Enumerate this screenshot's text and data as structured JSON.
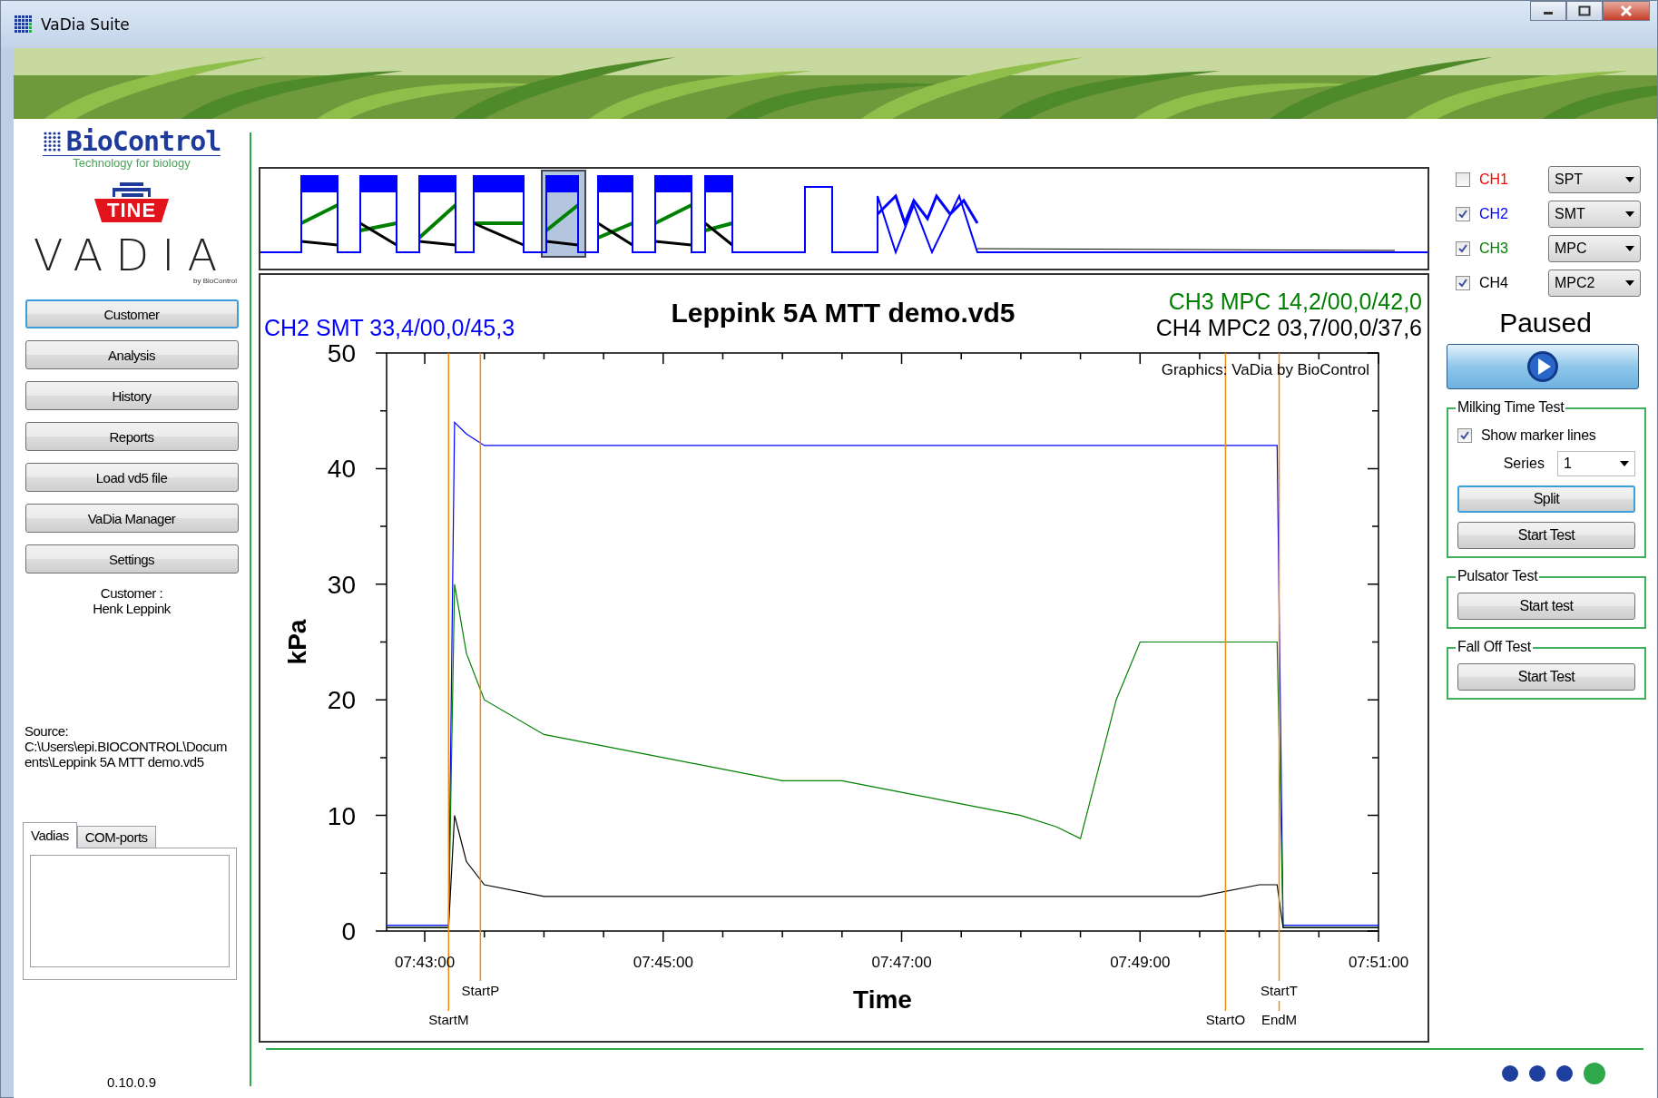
{
  "window": {
    "title": "VaDia Suite"
  },
  "sidebar": {
    "logos": {
      "brand": "BioControl",
      "tagline": "Technology for biology",
      "partner": "TINE",
      "product": "VADIA",
      "product_byline": "by BioControl"
    },
    "buttons": [
      {
        "label": "Customer",
        "focused": true
      },
      {
        "label": "Analysis",
        "focused": false
      },
      {
        "label": "History",
        "focused": false
      },
      {
        "label": "Reports",
        "focused": false
      },
      {
        "label": "Load vd5 file",
        "focused": false
      },
      {
        "label": "VaDia Manager",
        "focused": false
      },
      {
        "label": "Settings",
        "focused": false
      }
    ],
    "customer": {
      "label": "Customer :",
      "name": "Henk Leppink"
    },
    "source": {
      "label": "Source:",
      "path": "C:\\Users\\epi.BIOCONTROL\\Documents\\Leppink 5A MTT demo.vd5"
    },
    "tabs": [
      {
        "label": "Vadias",
        "selected": true
      },
      {
        "label": "COM-ports",
        "selected": false
      }
    ],
    "version": "0.10.0.9"
  },
  "chart_panel": {
    "title": "Leppink 5A MTT demo.vd5",
    "readings": [
      {
        "text": "CH2 SMT 33,4/00,0/45,3",
        "color": "#0000ff"
      },
      {
        "text": "CH3 MPC 14,2/00,0/42,0",
        "color": "#008000"
      },
      {
        "text": "CH4 MPC2 03,7/00,0/37,6",
        "color": "#000000"
      }
    ],
    "credit": "Graphics: VaDia by BioControl",
    "chart_data": {
      "type": "line",
      "xlabel": "Time",
      "ylabel": "kPa",
      "x": [
        27760.8,
        27792,
        27795,
        27801,
        27810,
        27840,
        27870,
        27900,
        27930,
        27960,
        27990,
        28020,
        28050,
        28080,
        28098,
        28110,
        28128,
        28140,
        28170,
        28200,
        28209,
        28212,
        28260
      ],
      "series": [
        {
          "color": "#0000ff",
          "values": [
            0.5,
            0.5,
            44,
            43,
            42,
            42,
            42,
            42,
            42,
            42,
            42,
            42,
            42,
            42,
            42,
            42,
            42,
            42,
            42,
            42,
            42,
            0.5,
            0.5
          ]
        },
        {
          "color": "#008000",
          "values": [
            0.3,
            0.3,
            30,
            24,
            20,
            17,
            16,
            15,
            14,
            13,
            13,
            12,
            11,
            10,
            9,
            8,
            20,
            25,
            25,
            25,
            25,
            0.3,
            0.3
          ]
        },
        {
          "color": "#000000",
          "values": [
            0.3,
            0.3,
            10,
            6,
            4,
            3,
            3,
            3,
            3,
            3,
            3,
            3,
            3,
            3,
            3,
            3,
            3,
            3,
            3,
            4,
            4,
            0.3,
            0.3
          ]
        }
      ],
      "xlim": [
        27760.8,
        28260
      ],
      "ylim": [
        0,
        50
      ],
      "xticks": [
        {
          "value": 27780,
          "label": "07:43:00"
        },
        {
          "value": 27900,
          "label": "07:45:00"
        },
        {
          "value": 28020,
          "label": "07:47:00"
        },
        {
          "value": 28140,
          "label": "07:49:00"
        },
        {
          "value": 28260,
          "label": "07:51:00"
        }
      ],
      "yticks": [
        0,
        10,
        20,
        30,
        40,
        50
      ],
      "ref_lines": [
        {
          "axis": "x",
          "value": 27792,
          "label": "StartM"
        },
        {
          "axis": "x",
          "value": 27808,
          "label": "StartP"
        },
        {
          "axis": "x",
          "value": 28183,
          "label": "StartO"
        },
        {
          "axis": "x",
          "value": 28210,
          "label": "StartT"
        },
        {
          "axis": "x",
          "value": 28210,
          "label": "EndM"
        }
      ]
    }
  },
  "channels": [
    {
      "label": "CH1",
      "checked": false,
      "color": "#ff0000",
      "mode": "SPT"
    },
    {
      "label": "CH2",
      "checked": true,
      "color": "#0000ff",
      "mode": "SMT"
    },
    {
      "label": "CH3",
      "checked": true,
      "color": "#008000",
      "mode": "MPC"
    },
    {
      "label": "CH4",
      "checked": true,
      "color": "#000000",
      "mode": "MPC2"
    }
  ],
  "status": "Paused",
  "milking_time_test": {
    "title": "Milking Time Test",
    "show_marker_lines": {
      "label": "Show marker lines",
      "checked": true
    },
    "series": {
      "label": "Series",
      "value": "1"
    },
    "buttons": [
      {
        "label": "Split",
        "focused": true
      },
      {
        "label": "Start Test",
        "focused": false
      }
    ]
  },
  "pulsator_test": {
    "title": "Pulsator Test",
    "button": "Start test"
  },
  "fall_off_test": {
    "title": "Fall Off Test",
    "button": "Start Test"
  },
  "status_dots": [
    {
      "color": "#1f3f9f"
    },
    {
      "color": "#1f3f9f"
    },
    {
      "color": "#1f3f9f"
    },
    {
      "color": "#2ea84a"
    }
  ]
}
